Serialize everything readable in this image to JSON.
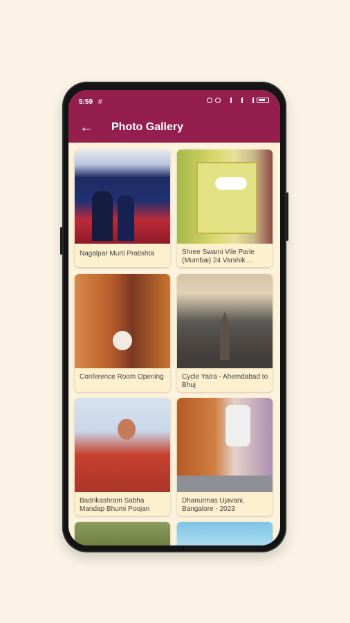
{
  "status_bar": {
    "time": "5:59",
    "extra": "#"
  },
  "app_bar": {
    "back_icon": "arrow-left-icon",
    "title": "Photo Gallery"
  },
  "colors": {
    "primary": "#941f4d",
    "background": "#fbf4e6",
    "card": "#fdf0cf"
  },
  "gallery": [
    {
      "caption": "Nagalpar Murti Pratishta"
    },
    {
      "caption": "Shree Swami Vile Parle (Mumbai) 24 Varshik ..."
    },
    {
      "caption": "Conference Room Opening"
    },
    {
      "caption": "Cycle Yatra - Ahemdabad to Bhuj"
    },
    {
      "caption": "Badrikashram Sabha Mandap Bhumi Poojan"
    },
    {
      "caption": "Dhanurmas Ujavani, Bangalore - 2023"
    }
  ]
}
